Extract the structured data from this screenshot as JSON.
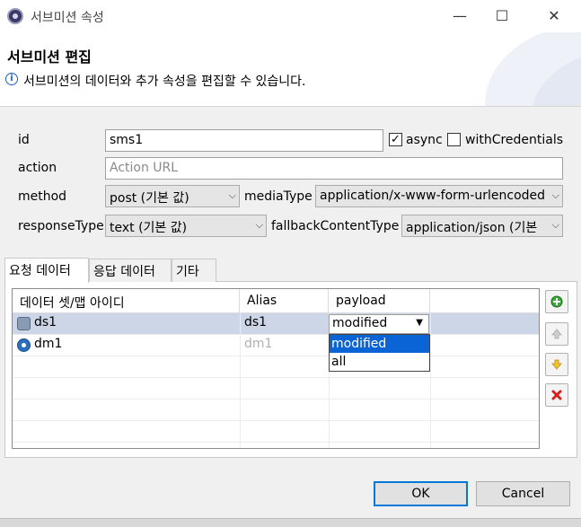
{
  "window": {
    "title": "서브미션 속성",
    "minimize": "—",
    "maximize": "☐",
    "close": "✕"
  },
  "header": {
    "title": "서브미션 편집",
    "description": "서브미션의 데이터와 추가 속성을 편집할 수 있습니다."
  },
  "form": {
    "id_label": "id",
    "id_value": "sms1",
    "async_label": "async",
    "async_checked": "✓",
    "with_credentials_label": "withCredentials",
    "action_label": "action",
    "action_placeholder": "Action URL",
    "method_label": "method",
    "method_value": "post (기본 값)",
    "media_type_label": "mediaType",
    "media_type_value": "application/x-www-form-urlencoded",
    "response_type_label": "responseType",
    "response_type_value": "text (기본 값)",
    "fallback_label": "fallbackContentType",
    "fallback_value": "application/json (기본"
  },
  "tabs": [
    "요청 데이터",
    "응답 데이터",
    "기타"
  ],
  "table": {
    "headers": [
      "데이터 셋/맵 아이디",
      "Alias",
      "payload"
    ],
    "rows": [
      {
        "id": "ds1",
        "alias": "ds1",
        "payload": "modified",
        "icon": "dataset-icon"
      },
      {
        "id": "dm1",
        "alias": "dm1",
        "payload": "",
        "icon": "datamap-icon"
      }
    ]
  },
  "payload_options": [
    "modified",
    "all"
  ],
  "buttons": {
    "ok": "OK",
    "cancel": "Cancel"
  },
  "colors": {
    "selection": "#0a64d6",
    "row_selected": "#ccd6e6",
    "default_button_border": "#0078d7"
  }
}
